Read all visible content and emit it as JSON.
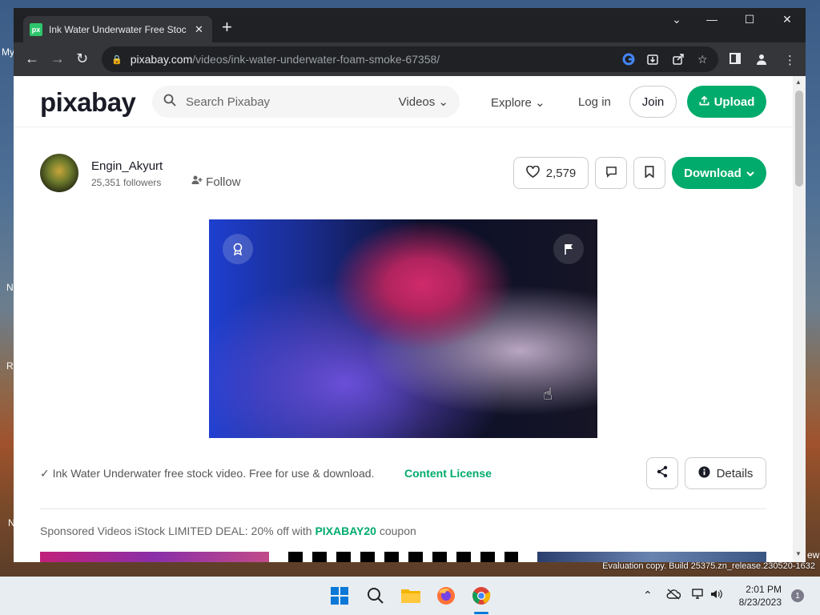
{
  "desktop": {
    "side_labels": [
      "My",
      "N",
      "R",
      "N"
    ],
    "watermark": "Evaluation copy. Build 25375.zn_release.230520-1632",
    "edge_label": "ew"
  },
  "browser": {
    "tab": {
      "favicon": "px",
      "title": "Ink Water Underwater Free Stock",
      "close": "✕"
    },
    "new_tab": "+",
    "window_controls": {
      "dropdown": "⌄",
      "minimize": "—",
      "maximize": "☐",
      "close": "✕"
    },
    "nav": {
      "back": "←",
      "forward": "→",
      "reload": "↻"
    },
    "url": {
      "host": "pixabay.com",
      "path": "/videos/ink-water-underwater-foam-smoke-67358/"
    }
  },
  "site": {
    "logo": "pixabay",
    "search": {
      "placeholder": "Search Pixabay",
      "media_type": "Videos"
    },
    "nav": {
      "explore": "Explore",
      "login": "Log in",
      "join": "Join",
      "upload": "Upload"
    }
  },
  "author": {
    "name": "Engin_Akyurt",
    "followers": "25,351 followers",
    "follow": "Follow"
  },
  "actions": {
    "likes": "2,579",
    "download": "Download"
  },
  "media": {
    "summary": "Ink Water Underwater free stock video. Free for use & download.",
    "license": "Content License",
    "details": "Details"
  },
  "sponsored": {
    "prefix": "Sponsored Videos iStock LIMITED DEAL: 20% off with ",
    "coupon": "PIXABAY20",
    "suffix": " coupon"
  },
  "taskbar": {
    "time": "2:01 PM",
    "date": "8/23/2023",
    "notifications": "1"
  },
  "colors": {
    "brand_green": "#00ab6b",
    "chrome_dark": "#202124"
  }
}
